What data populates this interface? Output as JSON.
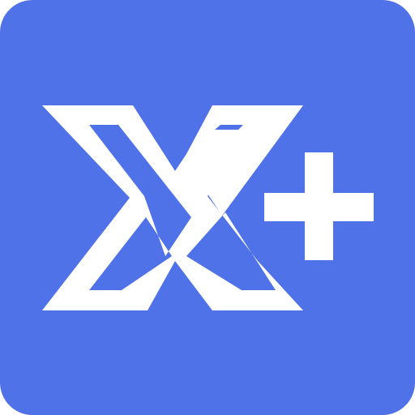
{
  "icon": {
    "name": "x-plus-app-icon",
    "background_color": "#4f72e8",
    "foreground_color": "#ffffff"
  }
}
